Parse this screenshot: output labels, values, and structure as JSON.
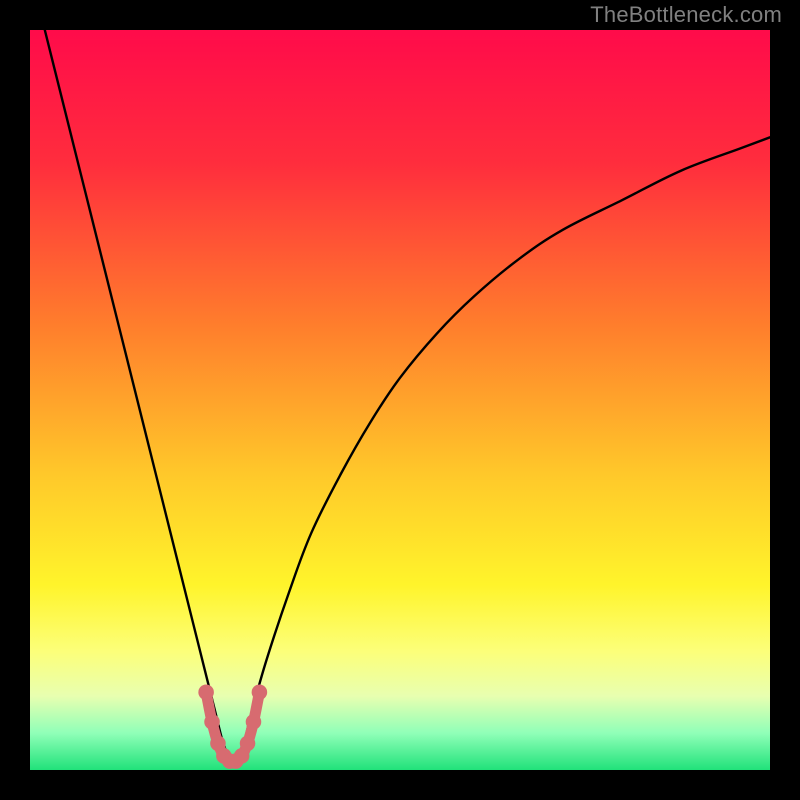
{
  "watermark": "TheBottleneck.com",
  "chart_data": {
    "type": "line",
    "title": "",
    "xlabel": "",
    "ylabel": "",
    "xlim": [
      0,
      100
    ],
    "ylim": [
      0,
      100
    ],
    "background_gradient": {
      "stops": [
        {
          "offset": 0,
          "color": "#ff0b4a"
        },
        {
          "offset": 18,
          "color": "#ff2d3d"
        },
        {
          "offset": 40,
          "color": "#ff7e2c"
        },
        {
          "offset": 60,
          "color": "#ffc82a"
        },
        {
          "offset": 75,
          "color": "#fff42b"
        },
        {
          "offset": 84,
          "color": "#fcff7a"
        },
        {
          "offset": 90,
          "color": "#e8ffb0"
        },
        {
          "offset": 95,
          "color": "#90ffb8"
        },
        {
          "offset": 100,
          "color": "#20e27a"
        }
      ]
    },
    "series": [
      {
        "name": "left-branch",
        "x": [
          2,
          4,
          6,
          8,
          10,
          12,
          14,
          16,
          18,
          20,
          22,
          23.5,
          25,
          26,
          27
        ],
        "values": [
          100,
          92,
          84,
          76,
          68,
          60,
          52,
          44,
          36,
          28,
          20,
          14,
          8,
          4,
          1.2
        ]
      },
      {
        "name": "right-branch",
        "x": [
          28,
          29,
          30,
          32,
          35,
          38,
          42,
          46,
          50,
          55,
          60,
          66,
          72,
          80,
          88,
          96,
          100
        ],
        "values": [
          1.2,
          4,
          8,
          15,
          24,
          32,
          40,
          47,
          53,
          59,
          64,
          69,
          73,
          77,
          81,
          84,
          85.5
        ]
      }
    ],
    "markers": {
      "name": "valley-markers",
      "color": "#d76b70",
      "points": [
        {
          "x": 23.8,
          "y": 10.5
        },
        {
          "x": 24.6,
          "y": 6.5
        },
        {
          "x": 25.4,
          "y": 3.6
        },
        {
          "x": 26.2,
          "y": 1.9
        },
        {
          "x": 27.0,
          "y": 1.2
        },
        {
          "x": 27.8,
          "y": 1.2
        },
        {
          "x": 28.6,
          "y": 1.9
        },
        {
          "x": 29.4,
          "y": 3.6
        },
        {
          "x": 30.2,
          "y": 6.5
        },
        {
          "x": 31.0,
          "y": 10.5
        }
      ]
    }
  }
}
